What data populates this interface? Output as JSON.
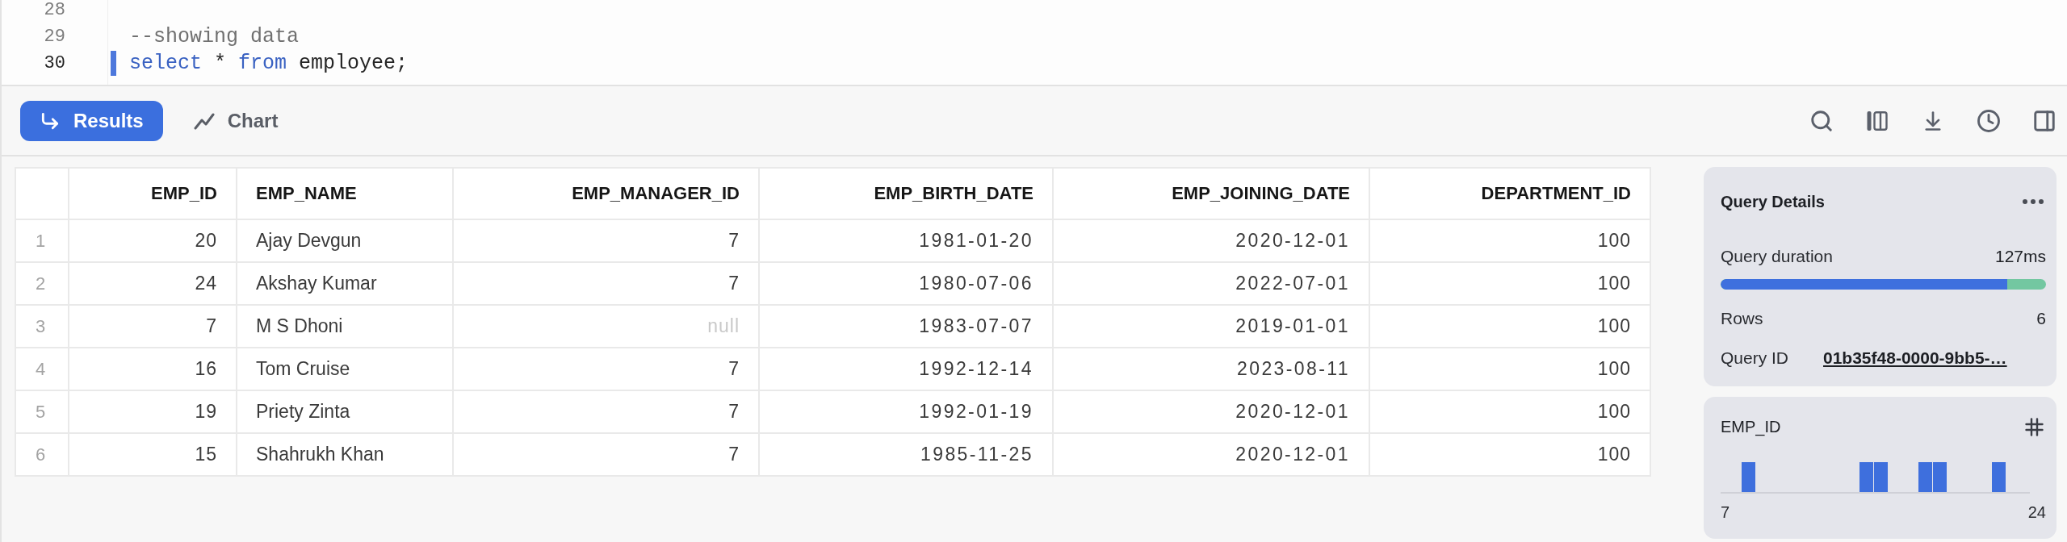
{
  "editor": {
    "lines": [
      {
        "number": "28",
        "current": false
      },
      {
        "number": "29",
        "current": false,
        "tokens": [
          {
            "kind": "comment",
            "text": "--showing data"
          }
        ]
      },
      {
        "number": "30",
        "current": true,
        "tokens": [
          {
            "kind": "keyword",
            "text": "select"
          },
          {
            "kind": "plain",
            "text": " * "
          },
          {
            "kind": "keyword",
            "text": "from"
          },
          {
            "kind": "plain",
            "text": " employee;"
          }
        ]
      }
    ]
  },
  "toolbar": {
    "tabs": [
      {
        "label": "Results",
        "selected": true
      },
      {
        "label": "Chart",
        "selected": false
      }
    ]
  },
  "table": {
    "columns": [
      {
        "label": "EMP_ID",
        "kind": "number"
      },
      {
        "label": "EMP_NAME",
        "kind": "text"
      },
      {
        "label": "EMP_MANAGER_ID",
        "kind": "number"
      },
      {
        "label": "EMP_BIRTH_DATE",
        "kind": "date"
      },
      {
        "label": "EMP_JOINING_DATE",
        "kind": "date"
      },
      {
        "label": "DEPARTMENT_ID",
        "kind": "number"
      }
    ],
    "rows": [
      {
        "number": "1",
        "cells": [
          {
            "text": "20",
            "is_null": false
          },
          {
            "text": "Ajay Devgun",
            "is_null": false
          },
          {
            "text": "7",
            "is_null": false
          },
          {
            "text": "1981-01-20",
            "is_null": false
          },
          {
            "text": "2020-12-01",
            "is_null": false
          },
          {
            "text": "100",
            "is_null": false
          }
        ]
      },
      {
        "number": "2",
        "cells": [
          {
            "text": "24",
            "is_null": false
          },
          {
            "text": "Akshay Kumar",
            "is_null": false
          },
          {
            "text": "7",
            "is_null": false
          },
          {
            "text": "1980-07-06",
            "is_null": false
          },
          {
            "text": "2022-07-01",
            "is_null": false
          },
          {
            "text": "100",
            "is_null": false
          }
        ]
      },
      {
        "number": "3",
        "cells": [
          {
            "text": "7",
            "is_null": false
          },
          {
            "text": "M S Dhoni",
            "is_null": false
          },
          {
            "text": "null",
            "is_null": true
          },
          {
            "text": "1983-07-07",
            "is_null": false
          },
          {
            "text": "2019-01-01",
            "is_null": false
          },
          {
            "text": "100",
            "is_null": false
          }
        ]
      },
      {
        "number": "4",
        "cells": [
          {
            "text": "16",
            "is_null": false
          },
          {
            "text": "Tom Cruise",
            "is_null": false
          },
          {
            "text": "7",
            "is_null": false
          },
          {
            "text": "1992-12-14",
            "is_null": false
          },
          {
            "text": "2023-08-11",
            "is_null": false
          },
          {
            "text": "100",
            "is_null": false
          }
        ]
      },
      {
        "number": "5",
        "cells": [
          {
            "text": "19",
            "is_null": false
          },
          {
            "text": "Priety Zinta",
            "is_null": false
          },
          {
            "text": "7",
            "is_null": false
          },
          {
            "text": "1992-01-19",
            "is_null": false
          },
          {
            "text": "2020-12-01",
            "is_null": false
          },
          {
            "text": "100",
            "is_null": false
          }
        ]
      },
      {
        "number": "6",
        "cells": [
          {
            "text": "15",
            "is_null": false
          },
          {
            "text": "Shahrukh Khan",
            "is_null": false
          },
          {
            "text": "7",
            "is_null": false
          },
          {
            "text": "1985-11-25",
            "is_null": false
          },
          {
            "text": "2020-12-01",
            "is_null": false
          },
          {
            "text": "100",
            "is_null": false
          }
        ]
      }
    ]
  },
  "query_details": {
    "title": "Query Details",
    "duration": {
      "label": "Query duration",
      "value": "127ms",
      "level": 0.88
    },
    "rows": {
      "label": "Rows",
      "value": "6"
    },
    "query_id": {
      "label": "Query ID",
      "value": "01b35f48-0000-9bb5-…"
    }
  },
  "column_summary": {
    "title": "EMP_ID",
    "min_label": "7",
    "max_label": "24"
  }
}
